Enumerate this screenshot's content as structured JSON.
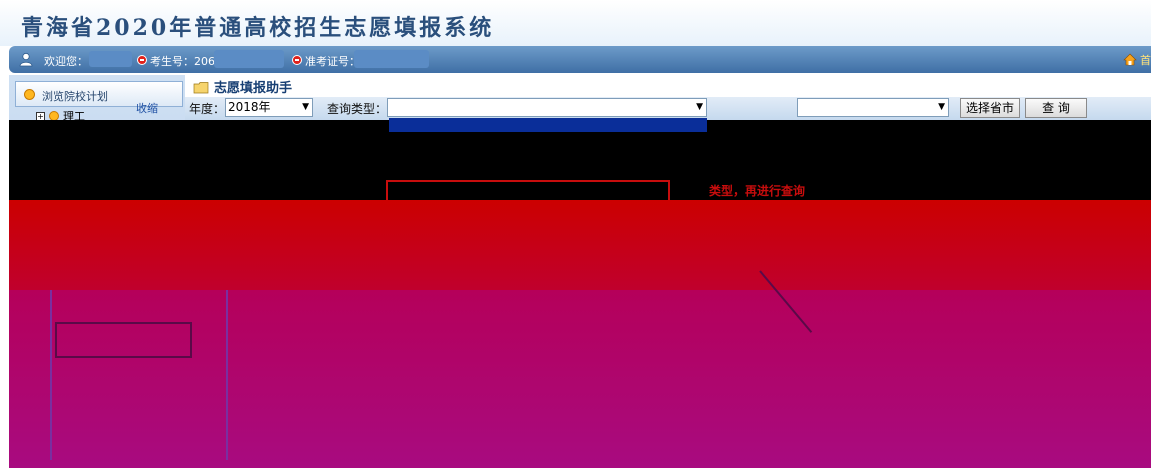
{
  "header": {
    "title": "青海省2020年普通高校招生志愿填报系统"
  },
  "info_bar": {
    "welcome_label": "欢迎您：",
    "exam_number_label": "考生号：206",
    "ticket_number_label": "准考证号：",
    "home_label": "首"
  },
  "sidebar": {
    "tab_label": "浏览院校计划",
    "collapse_label": "收缩",
    "tree_root_toggle": "+",
    "tree_root_label": "理工"
  },
  "helper": {
    "title": "志愿填报助手",
    "year_label": "年度：",
    "year_value": "2018年",
    "query_type_label": "查询类型：",
    "query_type_value": "",
    "school_label": "",
    "school_value": "",
    "select_province_button": "选择省市",
    "query_button": "查 询"
  },
  "hint": {
    "text": "类型，再进行查询"
  },
  "colors": {
    "title_color": "#2a4f7c",
    "info_bar_start": "#6d9bc9",
    "info_bar_end": "#3f6fa5",
    "dropdown_selected": "#0a2e99",
    "hint_red": "#c80d0d",
    "band_red": "#cc0000",
    "band_magenta": "#a80b80"
  },
  "icons": {
    "user": "user-icon",
    "home": "home-icon",
    "folder": "folder-icon",
    "tab": "circle-bullet-icon"
  }
}
